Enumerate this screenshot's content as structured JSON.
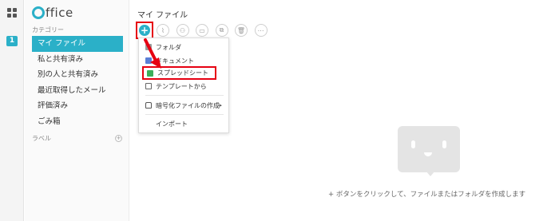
{
  "sidebar": {
    "app_name": "ffice",
    "category_label": "カテゴリー",
    "items": [
      {
        "label": "マイ ファイル"
      },
      {
        "label": "私と共有済み"
      },
      {
        "label": "別の人と共有済み"
      },
      {
        "label": "最近取得したメール"
      },
      {
        "label": "評価済み"
      },
      {
        "label": "ごみ箱"
      }
    ],
    "label_section": "ラベル",
    "add_label_icon": "+"
  },
  "rail": {
    "badge": "1"
  },
  "main": {
    "title": "マイ ファイル",
    "add_icon": "+",
    "toolbar_icons": [
      "paperclip-icon",
      "share-user-icon",
      "folder-move-icon",
      "copy-icon",
      "trash-icon",
      "more-icon"
    ],
    "toolbar_glyphs": [
      "⌇",
      "⚇",
      "▭",
      "⧉",
      "🗑",
      "⋯"
    ]
  },
  "dropdown": {
    "items": [
      {
        "label": "フォルダ",
        "icon": "folder-icon"
      },
      {
        "label": "ドキュメント",
        "icon": "document-icon"
      },
      {
        "label": "スプレッドシート",
        "icon": "spreadsheet-icon"
      },
      {
        "label": "テンプレートから",
        "icon": "template-icon"
      },
      {
        "label": "暗号化ファイルの作成",
        "icon": "lock-icon",
        "submenu_arrow": "▸"
      },
      {
        "label": "インポート",
        "icon": ""
      }
    ]
  },
  "empty_state": {
    "message": "+ ボタンをクリックして、ファイルまたはフォルダを作成します"
  },
  "colors": {
    "accent": "#2bb0c8",
    "highlight": "#e60012"
  }
}
